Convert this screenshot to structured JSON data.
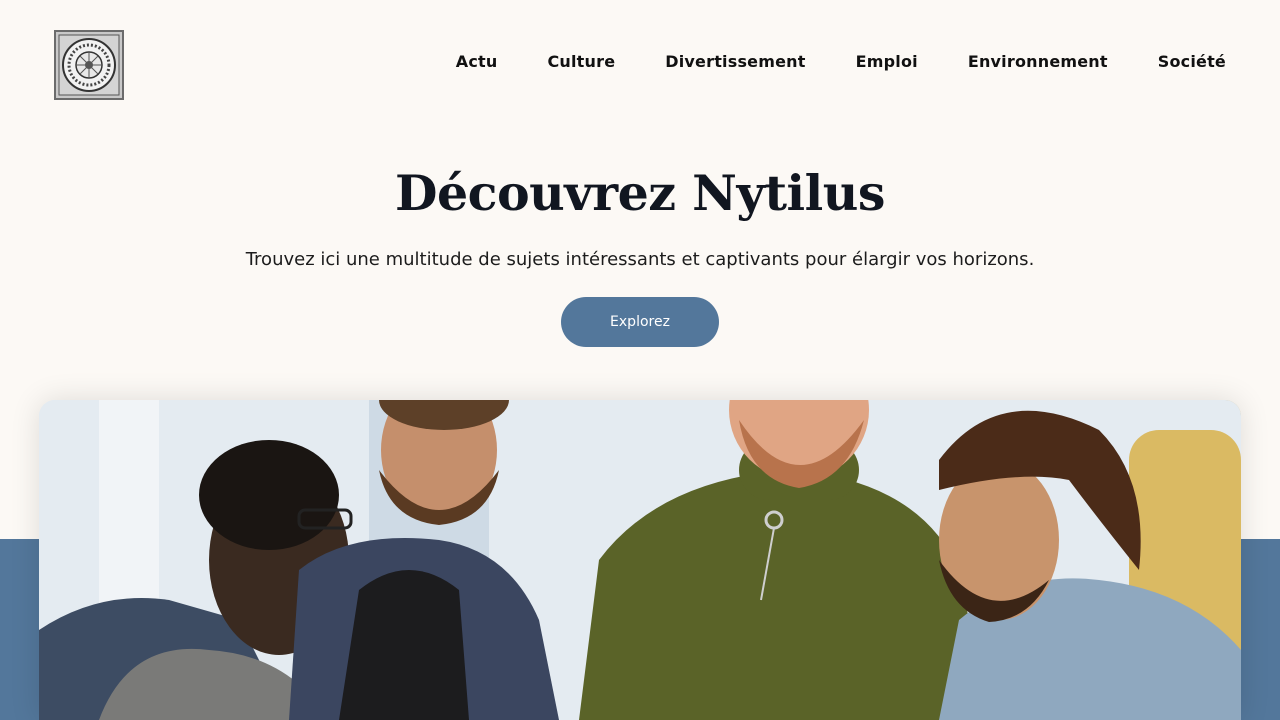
{
  "header": {
    "logo_alt": "Nytilus",
    "nav": [
      "Actu",
      "Culture",
      "Divertissement",
      "Emploi",
      "Environnement",
      "Société"
    ]
  },
  "hero": {
    "title": "Découvrez Nytilus",
    "subtitle": "Trouvez ici une multitude de sujets intéressants et captivants pour élargir vos horizons.",
    "cta_label": "Explorez"
  },
  "colors": {
    "background": "#fcf9f5",
    "accent": "#53779b",
    "title": "#111620"
  },
  "image": {
    "subject": "group-of-four-men-looking-down"
  }
}
